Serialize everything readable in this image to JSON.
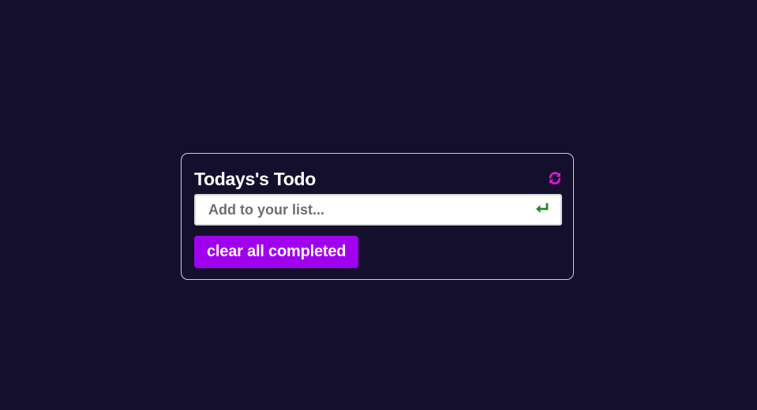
{
  "todo": {
    "title": "Todays's Todo",
    "input_placeholder": "Add to your list...",
    "input_value": "",
    "clear_button_label": "clear all completed"
  },
  "icons": {
    "refresh": "refresh-icon",
    "enter": "enter-icon"
  },
  "colors": {
    "background": "#140f2d",
    "accent": "#a100ef",
    "refresh_icon": "#e01ad9",
    "enter_icon": "#1f8a2e",
    "card_border": "#cfcfd8"
  }
}
